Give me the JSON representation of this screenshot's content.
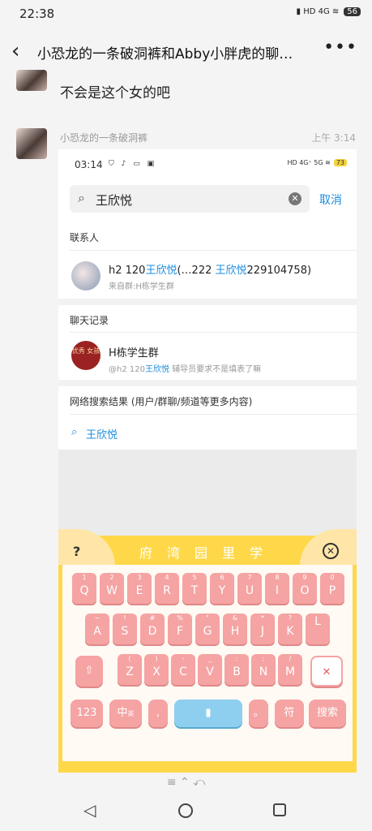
{
  "status": {
    "time": "22:38",
    "icons": "▮ HD 4G ≋",
    "battery": "56"
  },
  "header": {
    "back_icon": "chevron-left-icon",
    "title": "小恐龙的一条破洞裤和Abby小胖虎的聊…",
    "more_icon": "more-icon"
  },
  "messages": [
    {
      "text": "不会是这个女的吧"
    },
    {
      "sender": "小恐龙的一条破洞裤",
      "time": "上午 3:14"
    }
  ],
  "shot": {
    "status_time": "03:14",
    "status_icons": "⛉ ♪ ▭ ▣",
    "status_right": "HD 4G⁺ 5G ≋",
    "battery": "73",
    "search_value": "王欣悦",
    "cancel": "取消",
    "contacts_header": "联系人",
    "contact": {
      "name_prefix": "h2 120",
      "name_hl": "王欣悦",
      "name_mid": "(…222 ",
      "name_hl2": "王欣悦",
      "name_suffix": "229104758)",
      "sub": "来自群:H栋学生群"
    },
    "chat_header": "聊天记录",
    "group": {
      "avatar_text": "优秀 女孩",
      "name": "H栋学生群",
      "sub_prefix": "@h2 120",
      "sub_hl": "王欣悦",
      "sub_suffix": " 辅导员要求不是填表了嘛"
    },
    "web_header": "网络搜索结果 (用户/群聊/频道等更多内容)",
    "web_query": "王欣悦",
    "keyboard": {
      "help": "?",
      "candidates": "府湾园里学",
      "close": "⊗",
      "row1": [
        [
          "1",
          "Q"
        ],
        [
          "2",
          "W"
        ],
        [
          "3",
          "E"
        ],
        [
          "4",
          "R"
        ],
        [
          "5",
          "T"
        ],
        [
          "6",
          "Y"
        ],
        [
          "7",
          "U"
        ],
        [
          "8",
          "I"
        ],
        [
          "9",
          "O"
        ],
        [
          "0",
          "P"
        ]
      ],
      "row2": [
        [
          "~",
          "A"
        ],
        [
          "!",
          "S"
        ],
        [
          "#",
          "D"
        ],
        [
          "%",
          "F"
        ],
        [
          "\"",
          "G"
        ],
        [
          "&",
          "H"
        ],
        [
          "*",
          "J"
        ],
        [
          "?",
          "K"
        ],
        [
          "",
          "L"
        ]
      ],
      "row3": [
        [
          "(",
          "Z"
        ],
        [
          ")",
          "X"
        ],
        [
          "-",
          "C"
        ],
        [
          "_",
          "V"
        ],
        [
          ":",
          "B"
        ],
        [
          ";",
          "N"
        ],
        [
          "/",
          "M"
        ]
      ],
      "shift": "⇧",
      "delete": "✕",
      "num": "123",
      "lang": "中",
      "lang_sub": "英",
      "comma": ",",
      "period": "。",
      "mic": "🎙",
      "symbols": "符",
      "search": "搜索"
    }
  },
  "nav": {
    "gesture": "≡        ⌃        ⤺",
    "back": "◁"
  }
}
